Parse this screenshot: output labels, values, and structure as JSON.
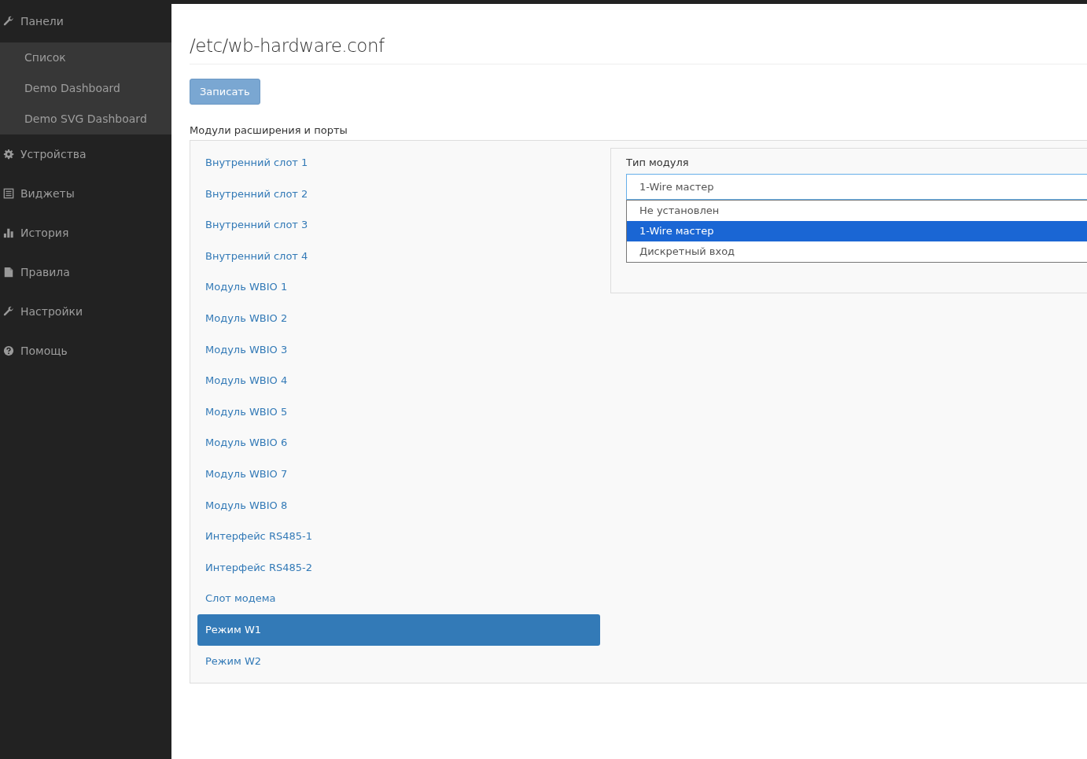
{
  "sidebar": {
    "items": [
      {
        "label": "Панели",
        "kind": "wrench",
        "expanded": true,
        "children": [
          {
            "label": "Список"
          },
          {
            "label": "Demo Dashboard"
          },
          {
            "label": "Demo SVG Dashboard"
          }
        ]
      },
      {
        "label": "Устройства",
        "kind": "gear"
      },
      {
        "label": "Виджеты",
        "kind": "list"
      },
      {
        "label": "История",
        "kind": "chart"
      },
      {
        "label": "Правила",
        "kind": "file"
      },
      {
        "label": "Настройки",
        "kind": "wrench"
      },
      {
        "label": "Помощь",
        "kind": "help"
      }
    ]
  },
  "page": {
    "title": "/etc/wb-hardware.conf",
    "save_button": "Записать",
    "section_title": "Модули расширения и порты"
  },
  "modules": [
    {
      "label": "Внутренний слот 1",
      "selected": false
    },
    {
      "label": "Внутренний слот 2",
      "selected": false
    },
    {
      "label": "Внутренний слот 3",
      "selected": false
    },
    {
      "label": "Внутренний слот 4",
      "selected": false
    },
    {
      "label": "Модуль WBIO 1",
      "selected": false
    },
    {
      "label": "Модуль WBIO 2",
      "selected": false
    },
    {
      "label": "Модуль WBIO 3",
      "selected": false
    },
    {
      "label": "Модуль WBIO 4",
      "selected": false
    },
    {
      "label": "Модуль WBIO 5",
      "selected": false
    },
    {
      "label": "Модуль WBIO 6",
      "selected": false
    },
    {
      "label": "Модуль WBIO 7",
      "selected": false
    },
    {
      "label": "Модуль WBIO 8",
      "selected": false
    },
    {
      "label": "Интерфейс RS485-1",
      "selected": false
    },
    {
      "label": "Интерфейс RS485-2",
      "selected": false
    },
    {
      "label": "Слот модема",
      "selected": false
    },
    {
      "label": "Режим W1",
      "selected": true
    },
    {
      "label": "Режим W2",
      "selected": false
    }
  ],
  "module_form": {
    "label": "Тип модуля",
    "value": "1-Wire мастер",
    "options": [
      {
        "label": "Не установлен",
        "selected": false
      },
      {
        "label": "1-Wire мастер",
        "selected": true
      },
      {
        "label": "Дискретный вход",
        "selected": false
      }
    ]
  }
}
